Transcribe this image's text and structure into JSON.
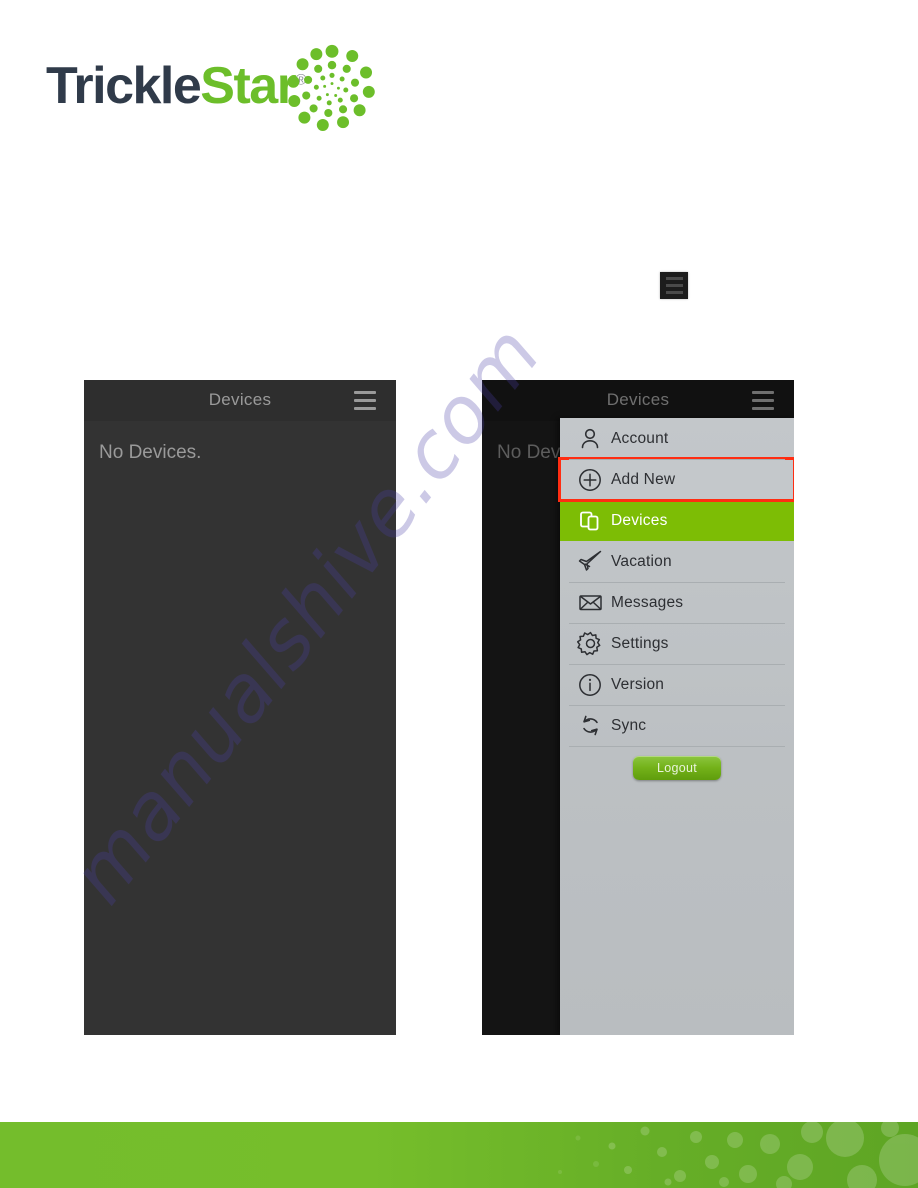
{
  "brand": {
    "name_part1": "Trickle",
    "name_part2": "Star",
    "registered_mark": "®",
    "logo_mark_icon": "radial-dot-spiral-icon",
    "green": "#6cbe2a",
    "dark": "#303b4a"
  },
  "standalone_menu_button": {
    "icon": "hamburger-menu-icon"
  },
  "screens": [
    {
      "id": "devices-empty",
      "title": "Devices",
      "menu_icon": "hamburger-menu-icon",
      "body_text": "No Devices."
    },
    {
      "id": "devices-menu-open",
      "title": "Devices",
      "menu_icon": "hamburger-menu-icon",
      "body_text": "No Devices."
    }
  ],
  "slide_menu": {
    "items": [
      {
        "label": "Account",
        "icon": "person-icon",
        "state": "normal"
      },
      {
        "label": "Add New",
        "icon": "plus-circle-icon",
        "state": "highlighted"
      },
      {
        "label": "Devices",
        "icon": "devices-icon",
        "state": "active"
      },
      {
        "label": "Vacation",
        "icon": "airplane-icon",
        "state": "normal"
      },
      {
        "label": "Messages",
        "icon": "envelope-icon",
        "state": "normal"
      },
      {
        "label": "Settings",
        "icon": "gear-icon",
        "state": "normal"
      },
      {
        "label": "Version",
        "icon": "info-circle-icon",
        "state": "normal"
      },
      {
        "label": "Sync",
        "icon": "sync-arrows-icon",
        "state": "normal"
      }
    ],
    "logout_label": "Logout",
    "active_color": "#7dbd05",
    "highlight_color": "#ff2d12",
    "panel_color": "#bfc3c6"
  },
  "footer": {
    "color_left": "#74bd2c",
    "color_right": "#5ea524",
    "pattern_icon": "circle-dots-pattern"
  },
  "watermark": {
    "text": "manualshive.com",
    "color": "#4b3fa8"
  }
}
